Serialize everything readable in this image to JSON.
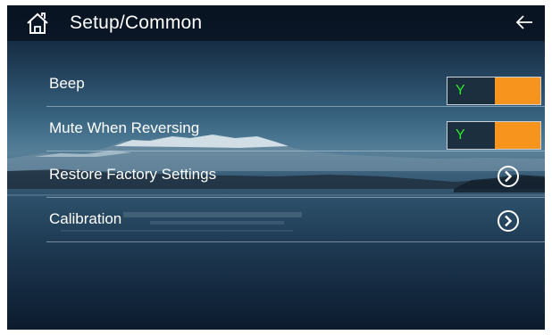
{
  "header": {
    "title": "Setup/Common",
    "home_icon": "home-icon",
    "back_icon": "back-arrow-icon"
  },
  "settings": [
    {
      "label": "Beep",
      "control": "toggle",
      "value": "Y"
    },
    {
      "label": "Mute When Reversing",
      "control": "toggle",
      "value": "Y"
    },
    {
      "label": "Restore Factory Settings",
      "control": "arrow",
      "icon": "chevron-right-circle-icon"
    },
    {
      "label": "Calibration",
      "control": "arrow",
      "icon": "chevron-right-circle-icon"
    }
  ],
  "colors": {
    "toggle_on_text": "#2ee82e",
    "toggle_knob": "#f7941d",
    "toggle_track": "#1b2f3f",
    "header_bg": "#08121f"
  }
}
